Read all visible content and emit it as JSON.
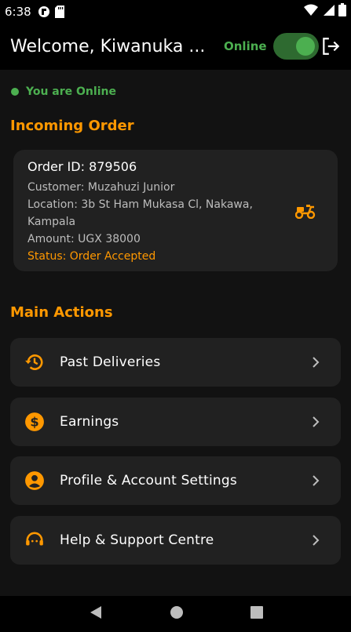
{
  "status_bar": {
    "time": "6:38"
  },
  "app_bar": {
    "title": "Welcome, Kiwanuka ...",
    "online_label": "Online"
  },
  "online_status": "You are Online",
  "incoming_order": {
    "section_title": "Incoming Order",
    "order_id": "Order ID: 879506",
    "customer": "Customer: Muzahuzi Junior",
    "location": "Location: 3b St Ham Mukasa Cl, Nakawa, Kampala",
    "amount": "Amount: UGX 38000",
    "status": "Status: Order Accepted"
  },
  "main_actions": {
    "section_title": "Main Actions",
    "items": [
      {
        "label": "Past Deliveries",
        "icon": "history-icon"
      },
      {
        "label": "Earnings",
        "icon": "dollar-icon"
      },
      {
        "label": "Profile & Account Settings",
        "icon": "account-icon"
      },
      {
        "label": "Help & Support Centre",
        "icon": "support-agent-icon"
      }
    ]
  },
  "colors": {
    "accent": "#ff9800",
    "online": "#4caf50",
    "card": "#212121",
    "background": "#121212"
  }
}
